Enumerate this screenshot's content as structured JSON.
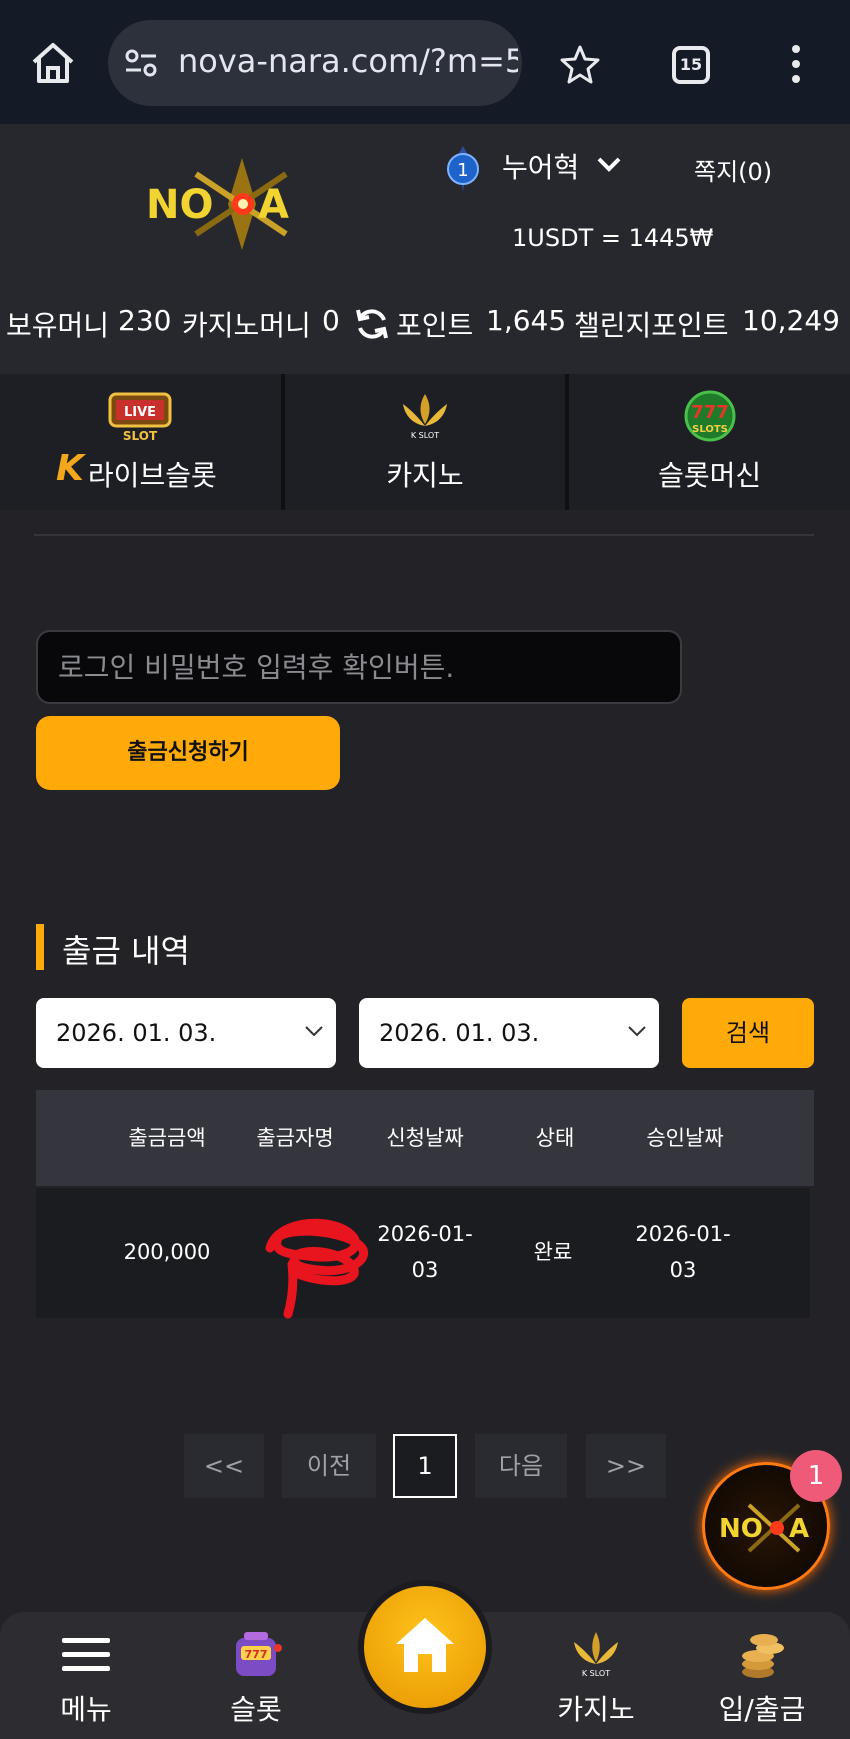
{
  "browser": {
    "url": "nova-nara.com/?m=5",
    "tab_count": "15"
  },
  "header": {
    "logo_text": "NOVA",
    "level": "1",
    "username": "누어혁",
    "messages_label": "쪽지(0)",
    "exchange_rate": "1USDT = 1445₩",
    "balances": {
      "holding_label": "보유머니",
      "holding_value": "230",
      "casino_label": "카지노머니",
      "casino_value": "0",
      "point_label": "포인트",
      "point_value": "1,645",
      "challenge_label": "챌린지포인트",
      "challenge_value": "10,249"
    }
  },
  "categories": [
    {
      "label": "라이브슬롯",
      "badge": "LIVE SLOT"
    },
    {
      "label": "카지노",
      "badge": "K SLOT"
    },
    {
      "label": "슬롯머신",
      "badge": "777 SLOTS"
    }
  ],
  "withdraw_form": {
    "password_placeholder": "로그인 비밀번호 입력후 확인버튼.",
    "submit_label": "출금신청하기"
  },
  "history": {
    "title": "출금 내역",
    "date_from": "2026. 01. 03.",
    "date_to": "2026. 01. 03.",
    "search_label": "검색",
    "columns": [
      "출금금액",
      "출금자명",
      "신청날짜",
      "상태",
      "승인날짜"
    ],
    "rows": [
      {
        "amount": "200,000",
        "name": "",
        "request_date_1": "2026-01-",
        "request_date_2": "03",
        "status": "완료",
        "approve_date_1": "2026-01-",
        "approve_date_2": "03"
      }
    ]
  },
  "pagination": {
    "first": "<<",
    "prev": "이전",
    "current": "1",
    "next": "다음",
    "last": ">>"
  },
  "floating": {
    "notification_count": "1"
  },
  "bottom_nav": {
    "menu": "메뉴",
    "slot": "슬롯",
    "casino": "카지노",
    "deposit": "입/출금"
  },
  "colors": {
    "accent": "#ffaa09",
    "background": "#232327",
    "notif": "#f05a79"
  }
}
